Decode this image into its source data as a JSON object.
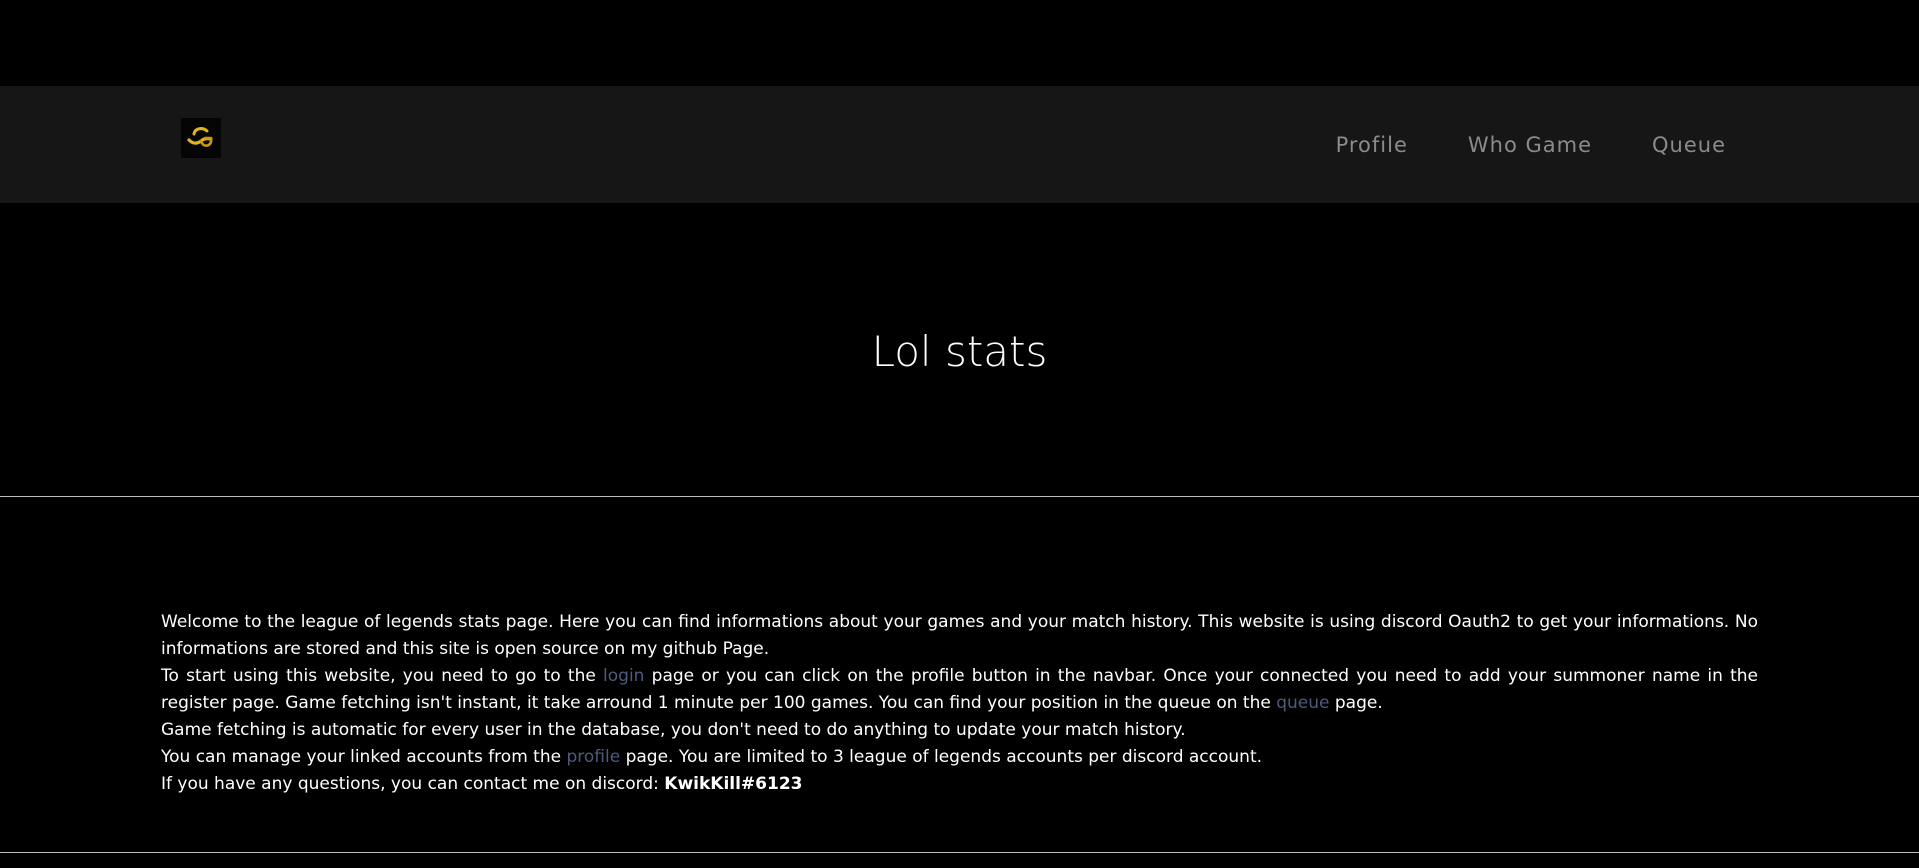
{
  "navbar": {
    "logo_alt": "site logo",
    "links": [
      "Profile",
      "Who Game",
      "Queue"
    ]
  },
  "hero": {
    "title": "Lol stats"
  },
  "content": {
    "p1": "Welcome to the league of legends stats page. Here you can find informations about your games and your match history. This website is using discord Oauth2 to get your informations. No informations are stored and this site is open source on my github Page.",
    "p2_before": "To start using this website, you need to go to the ",
    "p2_link1": "login",
    "p2_mid": " page or you can click on the profile button in the navbar. Once your connected you need to add your summoner name in the register page. Game fetching isn't instant, it take arround 1 minute per 100 games. You can find your position in the queue on the ",
    "p2_link2": "queue",
    "p2_after": " page.",
    "p3": "Game fetching is automatic for every user in the database, you don't need to do anything to update your match history.",
    "p4_before": "You can manage your linked accounts from the ",
    "p4_link": "profile",
    "p4_after": " page. You are limited to 3 league of legends accounts per discord account.",
    "p5_before": "If you have any questions, you can contact me on discord: ",
    "p5_bold": "KwikKill#6123"
  },
  "colors": {
    "background": "#000000",
    "navbar": "#161616",
    "nav_text": "#8b8b8b",
    "link": "#4d5b7c",
    "logo_accent": "#e3b21e"
  },
  "icons": {
    "logo": "brand-logo-icon"
  }
}
